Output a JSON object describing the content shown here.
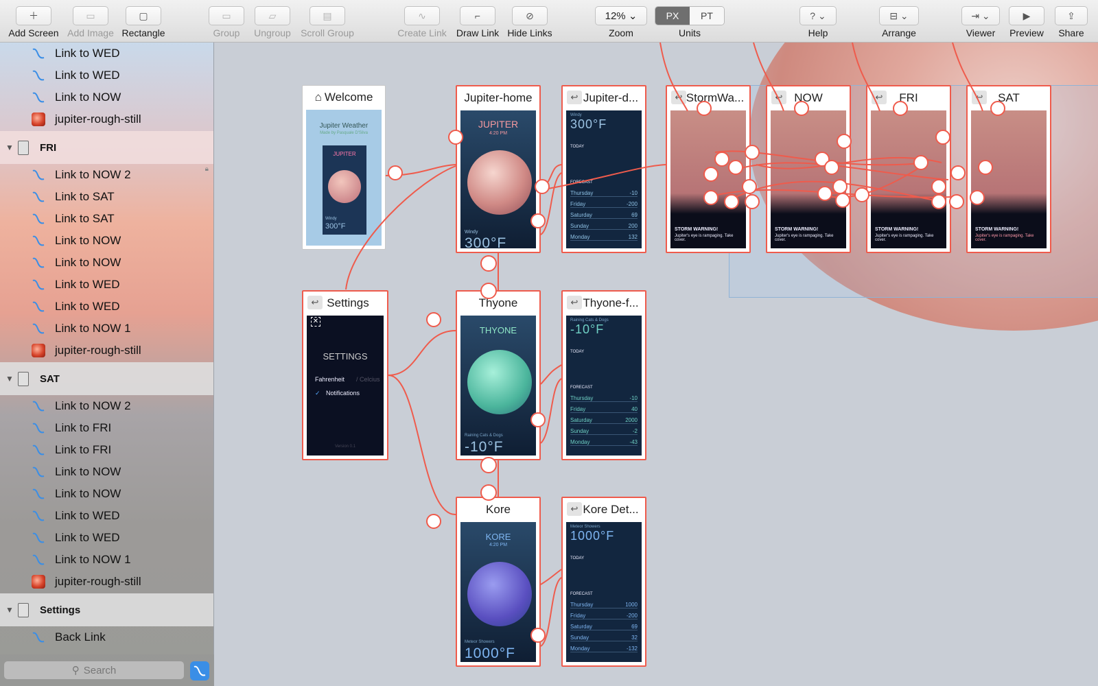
{
  "toolbar": {
    "add_screen": "Add Screen",
    "add_image": "Add Image",
    "rectangle": "Rectangle",
    "group": "Group",
    "ungroup": "Ungroup",
    "scroll_group": "Scroll Group",
    "create_link": "Create Link",
    "draw_link": "Draw Link",
    "hide_links": "Hide Links",
    "zoom_value": "12%",
    "zoom": "Zoom",
    "units_px": "PX",
    "units_pt": "PT",
    "units": "Units",
    "help": "Help",
    "arrange": "Arrange",
    "viewer": "Viewer",
    "preview": "Preview",
    "share": "Share"
  },
  "sidebar": {
    "top_items": [
      "Link to WED",
      "Link to WED",
      "Link to NOW",
      "jupiter-rough-still"
    ],
    "groups": [
      {
        "name": "FRI",
        "items": [
          "Link to NOW 2",
          "Link to SAT",
          "Link to SAT",
          "Link to NOW",
          "Link to NOW",
          "Link to WED",
          "Link to WED",
          "Link to NOW 1",
          "jupiter-rough-still"
        ]
      },
      {
        "name": "SAT",
        "items": [
          "Link to NOW 2",
          "Link to FRI",
          "Link to FRI",
          "Link to NOW",
          "Link to NOW",
          "Link to WED",
          "Link to WED",
          "Link to NOW 1",
          "jupiter-rough-still"
        ]
      },
      {
        "name": "Settings",
        "items": [
          "Back Link"
        ]
      }
    ],
    "search_placeholder": "Search"
  },
  "artboards": {
    "welcome": {
      "title": "Welcome",
      "app_title": "Jupiter Weather",
      "subtitle": "Made by Pasquale D'Silva",
      "planet": "JUPITER",
      "temp": "300°F",
      "label": "Windy"
    },
    "jupiter_home": {
      "title": "Jupiter-home",
      "planet": "JUPITER",
      "time": "4:20 PM",
      "label": "Windy",
      "temp": "300°F"
    },
    "jupiter_detail": {
      "title": "Jupiter-d...",
      "label": "Windy",
      "temp": "300°F",
      "today": "TODAY",
      "forecast": "FORECAST",
      "days": [
        "Thursday",
        "Friday",
        "Saturday",
        "Sunday",
        "Monday"
      ],
      "values": [
        "-10",
        "-200",
        "69",
        "200",
        "132"
      ]
    },
    "storm": {
      "title": "StormWa...",
      "warning": "STORM WARNING!",
      "warning_text": "Jupiter's eye is rampaging. Take cover."
    },
    "now": {
      "title": "NOW",
      "warning": "STORM WARNING!",
      "warning_text": "Jupiter's eye is rampaging. Take cover."
    },
    "fri": {
      "title": "FRI",
      "warning": "STORM WARNING!",
      "warning_text": "Jupiter's eye is rampaging. Take cover."
    },
    "sat": {
      "title": "SAT",
      "warning": "STORM WARNING!",
      "warning_text": "Jupiter's eye is rampaging. Take cover."
    },
    "settings": {
      "title": "Settings",
      "heading": "SETTINGS",
      "unit_on": "Fahrenheit",
      "unit_off": "/ Celcius",
      "notifications": "Notifications",
      "version": "Version 0.1"
    },
    "thyone": {
      "title": "Thyone",
      "planet": "THYONE",
      "label": "Raining Cats & Dogs",
      "temp": "-10°F"
    },
    "thyone_f": {
      "title": "Thyone-f...",
      "label": "Raining Cats & Dogs",
      "temp": "-10°F",
      "today": "TODAY",
      "forecast": "FORECAST",
      "days": [
        "Thursday",
        "Friday",
        "Saturday",
        "Sunday",
        "Monday"
      ],
      "values": [
        "-10",
        "40",
        "2000",
        "-2",
        "-43"
      ]
    },
    "kore": {
      "title": "Kore",
      "planet": "KORE",
      "time": "4:20 PM",
      "label": "Meteor Showers",
      "temp": "1000°F"
    },
    "kore_detail": {
      "title": "Kore Det...",
      "label": "Meteor Showers",
      "temp": "1000°F",
      "today": "TODAY",
      "forecast": "FORECAST",
      "days": [
        "Thursday",
        "Friday",
        "Saturday",
        "Sunday",
        "Monday"
      ],
      "values": [
        "1000",
        "-200",
        "69",
        "32",
        "-132"
      ]
    }
  },
  "colors": {
    "link": "#ef5b4c",
    "accent": "#3a8ee6"
  }
}
